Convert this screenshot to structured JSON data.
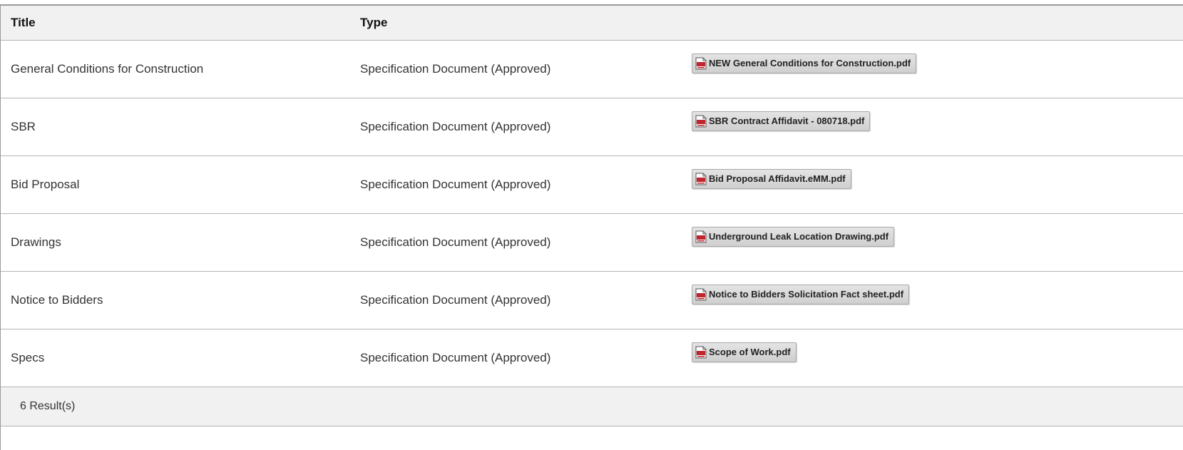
{
  "table": {
    "headers": {
      "title": "Title",
      "type": "Type",
      "file": ""
    },
    "rows": [
      {
        "title": "General Conditions for Construction",
        "type": "Specification Document (Approved)",
        "file": "NEW General Conditions for Construction.pdf",
        "file_icon": "pdf-icon"
      },
      {
        "title": "SBR",
        "type": "Specification Document (Approved)",
        "file": "SBR Contract Affidavit - 080718.pdf",
        "file_icon": "pdf-icon"
      },
      {
        "title": "Bid Proposal",
        "type": "Specification Document (Approved)",
        "file": "Bid Proposal Affidavit.eMM.pdf",
        "file_icon": "pdf-icon"
      },
      {
        "title": "Drawings",
        "type": "Specification Document (Approved)",
        "file": "Underground Leak Location Drawing.pdf",
        "file_icon": "pdf-icon"
      },
      {
        "title": "Notice to Bidders",
        "type": "Specification Document (Approved)",
        "file": "Notice to Bidders Solicitation Fact sheet.pdf",
        "file_icon": "pdf-icon"
      },
      {
        "title": "Specs",
        "type": "Specification Document (Approved)",
        "file": "Scope of Work.pdf",
        "file_icon": "pdf-icon"
      }
    ]
  },
  "footer": {
    "result_count": "6 Result(s)"
  },
  "colors": {
    "header_bg": "#f1f1f1",
    "border": "#b4b4b4",
    "pdf_red": "#c0262d"
  }
}
